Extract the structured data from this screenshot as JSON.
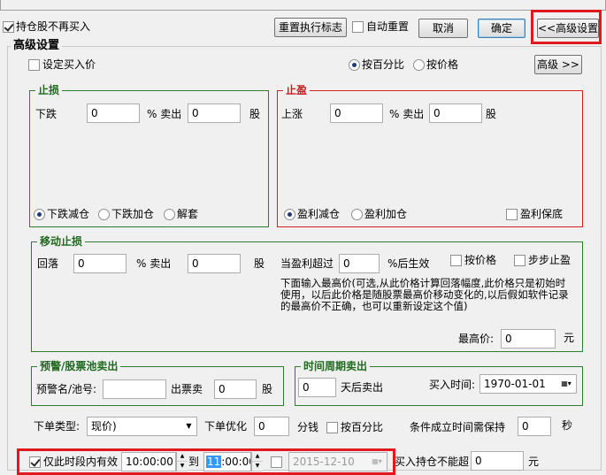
{
  "top": {
    "hold_no_buy": "持仓股不再买入",
    "reset_flag_btn": "重置执行标志",
    "auto_reset": "自动重置",
    "cancel_btn": "取消",
    "ok_btn": "确定",
    "advanced_settings_btn": "<<高级设置"
  },
  "advanced": {
    "group_title": "高级设置",
    "set_buy_price": "设定买入价",
    "by_percent": "按百分比",
    "by_price": "按价格",
    "advanced_btn": "高级 >>"
  },
  "stop_loss": {
    "title": "止损",
    "fall_label": "下跌",
    "fall_value": "0",
    "percent_sell": "% 卖出",
    "sell_value": "0",
    "shares": "股",
    "opt_reduce": "下跌减仓",
    "opt_add": "下跌加仓",
    "opt_unlock": "解套"
  },
  "take_profit": {
    "title": "止盈",
    "rise_label": "上涨",
    "rise_value": "0",
    "percent_sell": "% 卖出",
    "sell_value": "0",
    "shares": "股",
    "opt_reduce": "盈利减仓",
    "opt_add": "盈利加仓",
    "opt_keep": "盈利保底"
  },
  "trailing": {
    "title": "移动止损",
    "pullback_label": "回落",
    "pullback_value": "0",
    "percent_sell": "% 卖出",
    "sell_value": "0",
    "shares": "股",
    "profit_exceed": "当盈利超过",
    "profit_value": "0",
    "percent_effective": "%后生效",
    "by_price": "按价格",
    "step_stop": "步步止盈",
    "note": "下面输入最高价(可选,从此价格计算回落幅度,此价格只是初始时使用，以后此价格是随股票最高价移动变化的,以后假如软件记录的最高价不正确，也可以重新设定这个值)",
    "highest_label": "最高价:",
    "highest_value": "0",
    "currency": "元"
  },
  "alert": {
    "title": "预警/股票池卖出",
    "name_label": "预警名/池号:",
    "name_value": "",
    "sell_count_label": "出票卖",
    "sell_count_value": "0",
    "shares": "股"
  },
  "period": {
    "title": "时间周期卖出",
    "days_value": "0",
    "days_label": "天后卖出",
    "buy_time_label": "买入时间:",
    "buy_time_value": "1970-01-01"
  },
  "order": {
    "type_label": "下单类型:",
    "type_value": "现价)",
    "optimize_label": "下单优化",
    "optimize_value": "0",
    "unit": "分钱",
    "by_percent": "按百分比",
    "hold_label": "条件成立时间需保持",
    "hold_value": "0",
    "seconds": "秒"
  },
  "bottom": {
    "only_period": "仅此时段内有效",
    "start_time": "10:00:00",
    "to": "到",
    "end_time_sel": "11",
    "end_time_rest": ":00:00",
    "date_value": "2015-12-10",
    "buy_hold_label": "买入持仓不能超",
    "buy_hold_value": "0",
    "currency": "元"
  }
}
